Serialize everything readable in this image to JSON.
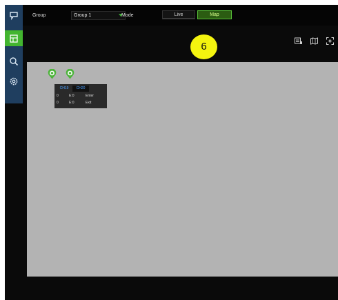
{
  "sidebar": {
    "items": [
      {
        "icon": "live-view-icon",
        "active": false
      },
      {
        "icon": "playback-icon",
        "active": true
      },
      {
        "icon": "search-icon",
        "active": false
      },
      {
        "icon": "settings-icon",
        "active": false
      }
    ]
  },
  "topbar": {
    "group_label": "Group",
    "group_value": "Group 1",
    "mode_label": "Mode",
    "modes": [
      "Live",
      "Map"
    ],
    "active_mode": "Map"
  },
  "annotation": {
    "badge": "6"
  },
  "toolbar": {
    "icons": [
      "map-list-icon",
      "map-edit-icon",
      "fullscreen-icon"
    ]
  },
  "map": {
    "pins": [
      {
        "icon": "camera-pin-icon"
      },
      {
        "icon": "camera-pin-icon"
      }
    ],
    "popup": {
      "tabs": [
        "CH19",
        "CH20"
      ],
      "rows": [
        {
          "id": "0",
          "field": "E:0",
          "action": "Enter"
        },
        {
          "id": "0",
          "field": "E:0",
          "action": "Exit"
        }
      ]
    }
  },
  "colors": {
    "sidebar": "#1f3e5f",
    "accent_green": "#43b52f",
    "map_background": "#b3b3b3",
    "badge": "#f4f40f",
    "tab_text": "#4aa0ff"
  }
}
